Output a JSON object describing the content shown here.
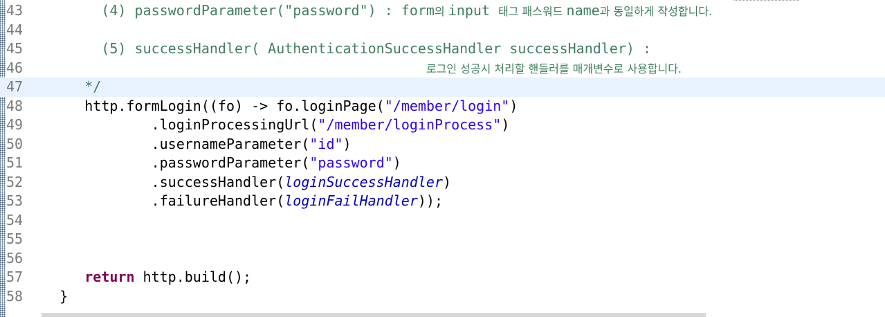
{
  "editor": {
    "lines": [
      {
        "number": "43",
        "parts": [
          {
            "t": "        (4) passwordParameter(\"password\") : form",
            "c": "cm"
          },
          {
            "t": "의 ",
            "c": "cmk"
          },
          {
            "t": "input ",
            "c": "cm"
          },
          {
            "t": "태그 패스워드 ",
            "c": "cmk"
          },
          {
            "t": "name",
            "c": "cm"
          },
          {
            "t": "과 동일하게 작성합니다.",
            "c": "cmk"
          }
        ]
      },
      {
        "number": "44",
        "parts": []
      },
      {
        "number": "45",
        "parts": [
          {
            "t": "        (5) successHandler( AuthenticationSuccessHandler successHandler) :",
            "c": "cm"
          }
        ]
      },
      {
        "number": "46",
        "parts": [
          {
            "t": "                                               ",
            "c": "cm"
          },
          {
            "t": "로그인 성공시 처리할 핸들러를 매개변수로 사용합니다.",
            "c": "cmk"
          }
        ]
      },
      {
        "number": "47",
        "current": true,
        "parts": [
          {
            "t": "      */",
            "c": "cm"
          }
        ]
      },
      {
        "number": "48",
        "parts": [
          {
            "t": "      http.formLogin((fo) -> fo.loginPage(",
            "c": "plain"
          },
          {
            "t": "\"/member/login\"",
            "c": "str"
          },
          {
            "t": ")",
            "c": "plain"
          }
        ]
      },
      {
        "number": "49",
        "parts": [
          {
            "t": "              .loginProcessingUrl(",
            "c": "plain"
          },
          {
            "t": "\"/member/loginProcess\"",
            "c": "str"
          },
          {
            "t": ")",
            "c": "plain"
          }
        ]
      },
      {
        "number": "50",
        "parts": [
          {
            "t": "              .usernameParameter(",
            "c": "plain"
          },
          {
            "t": "\"id\"",
            "c": "str"
          },
          {
            "t": ")",
            "c": "plain"
          }
        ]
      },
      {
        "number": "51",
        "parts": [
          {
            "t": "              .passwordParameter(",
            "c": "plain"
          },
          {
            "t": "\"password\"",
            "c": "str"
          },
          {
            "t": ")",
            "c": "plain"
          }
        ]
      },
      {
        "number": "52",
        "parts": [
          {
            "t": "              .successHandler(",
            "c": "plain"
          },
          {
            "t": "loginSuccessHandler",
            "c": "fld"
          },
          {
            "t": ")",
            "c": "plain"
          }
        ]
      },
      {
        "number": "53",
        "parts": [
          {
            "t": "              .failureHandler(",
            "c": "plain"
          },
          {
            "t": "loginFailHandler",
            "c": "fld"
          },
          {
            "t": "));",
            "c": "plain"
          }
        ]
      },
      {
        "number": "54",
        "parts": []
      },
      {
        "number": "55",
        "parts": []
      },
      {
        "number": "56",
        "parts": []
      },
      {
        "number": "57",
        "parts": [
          {
            "t": "      ",
            "c": "plain"
          },
          {
            "t": "return",
            "c": "kw"
          },
          {
            "t": " http.build();",
            "c": "plain"
          }
        ]
      },
      {
        "number": "58",
        "parts": [
          {
            "t": "   }",
            "c": "plain"
          }
        ]
      }
    ]
  }
}
